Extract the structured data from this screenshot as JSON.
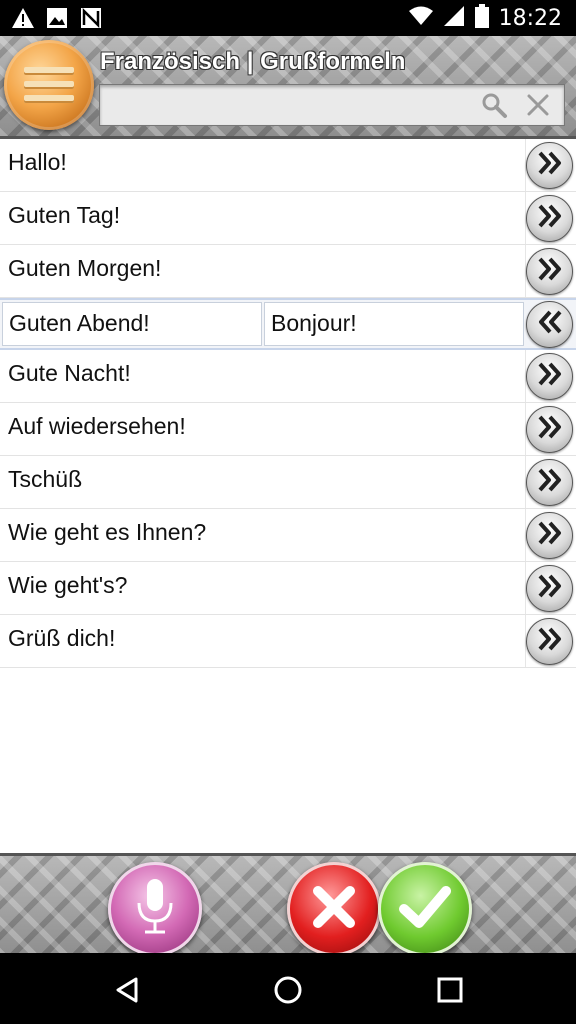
{
  "status_bar": {
    "time": "18:22",
    "icons_left": [
      "warning-icon",
      "image-icon",
      "no-signal-icon"
    ],
    "icons_right": [
      "wifi-icon",
      "cellular-icon",
      "battery-icon"
    ]
  },
  "header": {
    "title": "Französisch | Grußformeln",
    "search": {
      "value": "",
      "placeholder": ""
    }
  },
  "list": {
    "items": [
      {
        "de": "Hallo!"
      },
      {
        "de": "Guten Tag!"
      },
      {
        "de": "Guten Morgen!"
      },
      {
        "de": "Guten Abend!",
        "fr": "Bonjour!"
      },
      {
        "de": "Gute Nacht!"
      },
      {
        "de": "Auf wiedersehen!"
      },
      {
        "de": "Tschüß"
      },
      {
        "de": "Wie geht es Ihnen?"
      },
      {
        "de": "Wie geht's?"
      },
      {
        "de": "Grüß dich!"
      }
    ]
  },
  "toolbar": {
    "buttons": [
      "microphone-icon",
      "cancel-icon",
      "check-icon"
    ]
  },
  "nav": [
    "back-icon",
    "home-icon",
    "recents-icon"
  ]
}
